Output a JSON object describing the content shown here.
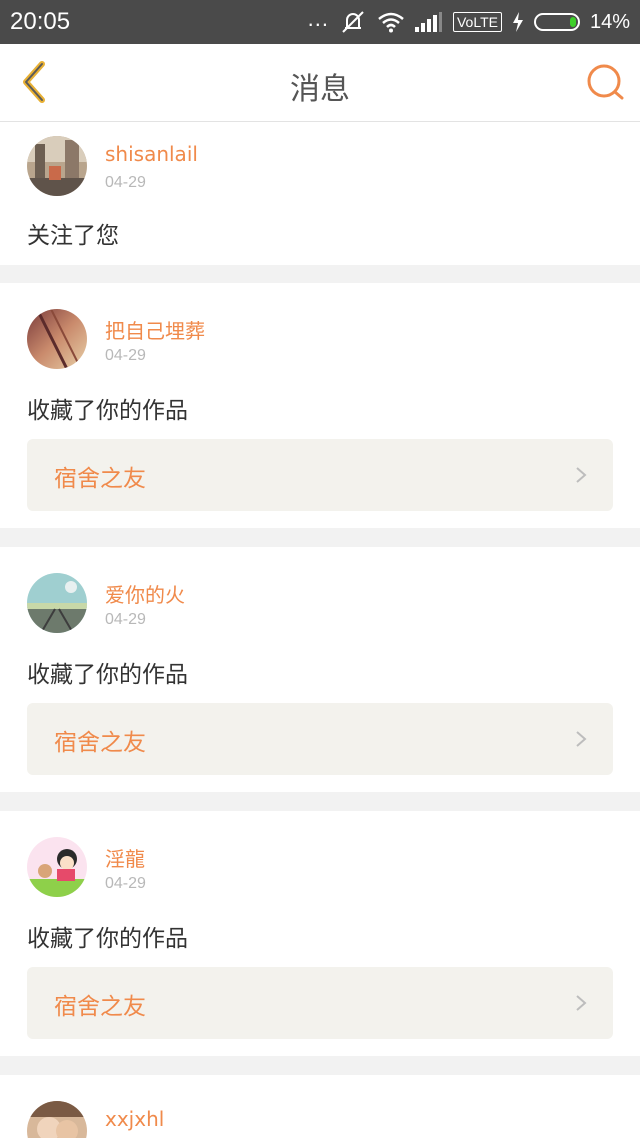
{
  "status_bar": {
    "time": "20:05",
    "dots": "...",
    "network_label": "VoLTE",
    "battery_percent": "14%",
    "battery_level": 0.14
  },
  "nav": {
    "title": "消息",
    "back_icon": "chevron-left-icon",
    "search_icon": "search-icon",
    "accent_color": "#f08a4b"
  },
  "messages": [
    {
      "username": "shisanlail",
      "date": "04-29",
      "action": "关注了您"
    },
    {
      "username": "把自己埋葬",
      "date": "04-29",
      "action": "收藏了你的作品",
      "work_title": "宿舍之友"
    },
    {
      "username": "爱你的火",
      "date": "04-29",
      "action": "收藏了你的作品",
      "work_title": "宿舍之友"
    },
    {
      "username": "淫龍",
      "date": "04-29",
      "action": "收藏了你的作品",
      "work_title": "宿舍之友"
    },
    {
      "username": "xxjxhl"
    }
  ]
}
